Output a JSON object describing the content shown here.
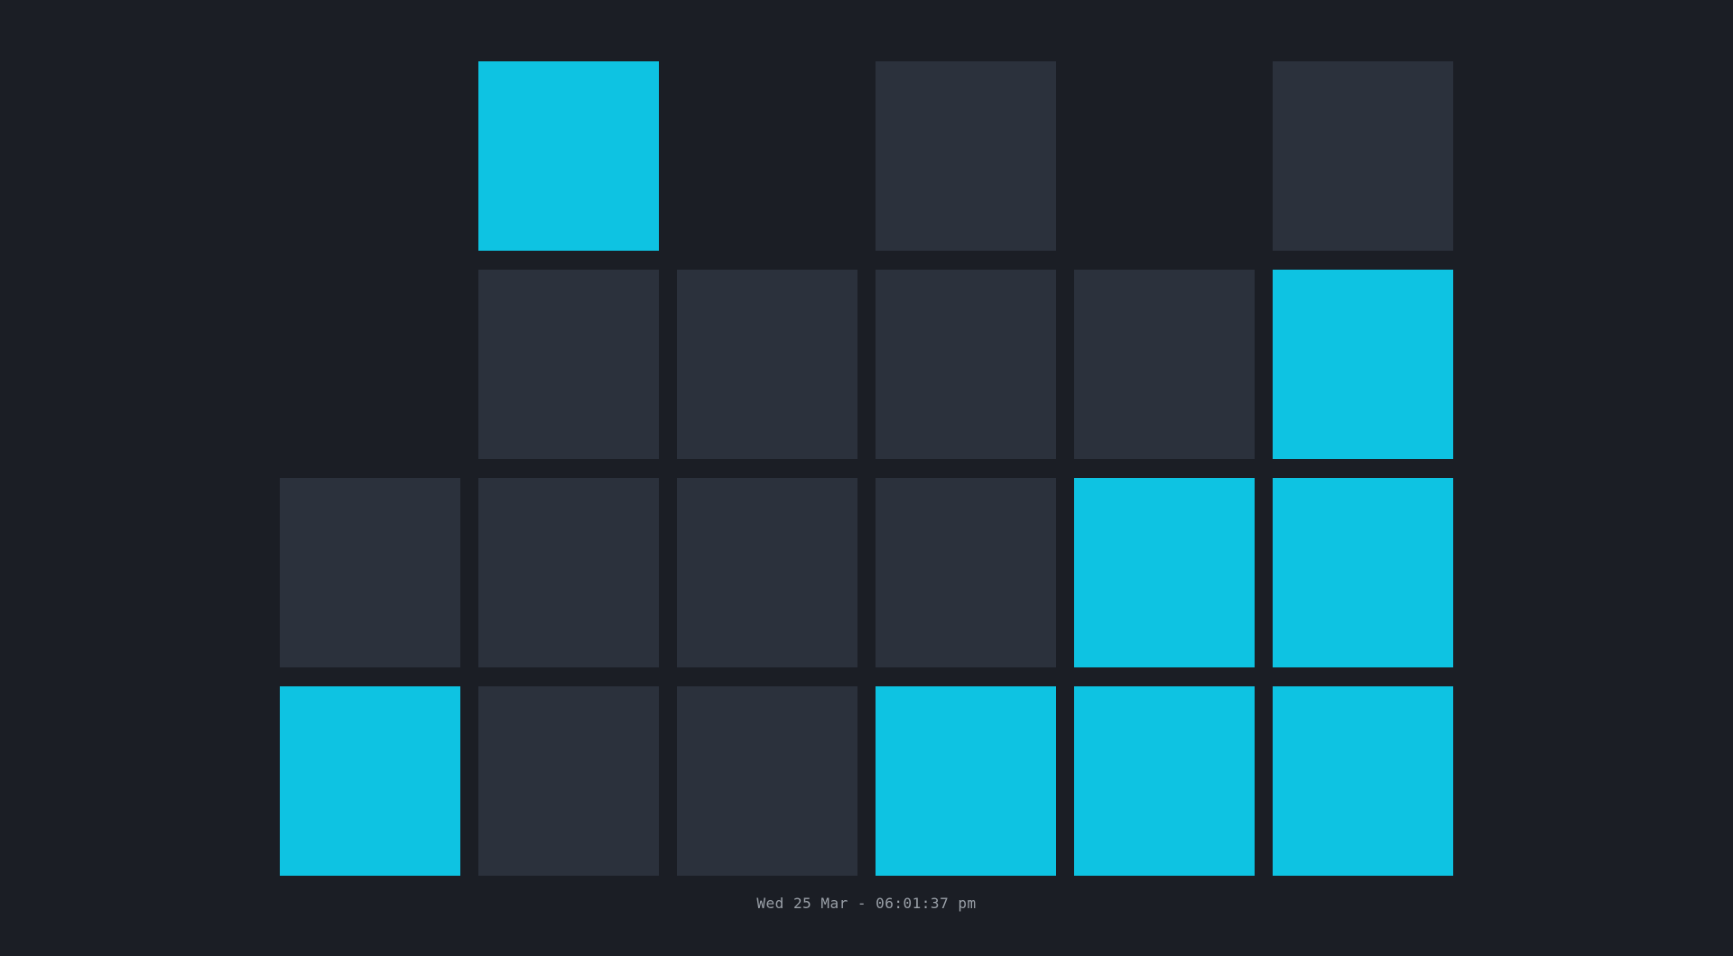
{
  "colors": {
    "background": "#1b1e25",
    "bit_on": "#0ec3e2",
    "bit_off": "#2b313c",
    "text": "#9aa0a8"
  },
  "binary_clock": {
    "columns": [
      {
        "digit": 0,
        "bits": [
          null,
          null,
          0,
          1
        ]
      },
      {
        "digit": 6,
        "bits": [
          1,
          0,
          0,
          0
        ]
      },
      {
        "digit": 0,
        "bits": [
          null,
          0,
          0,
          0
        ]
      },
      {
        "digit": 1,
        "bits": [
          0,
          0,
          0,
          1
        ]
      },
      {
        "digit": 3,
        "bits": [
          null,
          0,
          1,
          1
        ]
      },
      {
        "digit": 7,
        "bits": [
          0,
          1,
          1,
          1
        ]
      }
    ]
  },
  "readout": {
    "text": "Wed 25 Mar - 06:01:37 pm"
  }
}
